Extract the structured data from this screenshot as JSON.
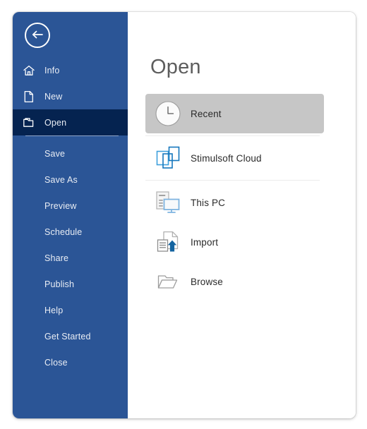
{
  "window": {
    "accent_blue": "#2b5596",
    "accent_blue_active": "#052350",
    "selected_row_gray": "#c6c6c6",
    "icon_blue": "#1e86c8"
  },
  "sidebar": {
    "back_button": {
      "name": "back-arrow-button",
      "icon": "back-arrow-icon"
    },
    "items": [
      {
        "label": "Info",
        "icon": "home-icon",
        "icon_type": "home",
        "active": false,
        "has_icon": true,
        "separator_after": false
      },
      {
        "label": "New",
        "icon": "page-icon",
        "icon_type": "page",
        "active": false,
        "has_icon": true,
        "separator_after": false
      },
      {
        "label": "Open",
        "icon": "folder-icon",
        "icon_type": "folder",
        "active": true,
        "has_icon": true,
        "separator_after": true
      },
      {
        "label": "Save",
        "icon": "",
        "icon_type": "",
        "active": false,
        "has_icon": false,
        "separator_after": false
      },
      {
        "label": "Save As",
        "icon": "",
        "icon_type": "",
        "active": false,
        "has_icon": false,
        "separator_after": false
      },
      {
        "label": "Preview",
        "icon": "",
        "icon_type": "",
        "active": false,
        "has_icon": false,
        "separator_after": false
      },
      {
        "label": "Schedule",
        "icon": "",
        "icon_type": "",
        "active": false,
        "has_icon": false,
        "separator_after": false
      },
      {
        "label": "Share",
        "icon": "",
        "icon_type": "",
        "active": false,
        "has_icon": false,
        "separator_after": false
      },
      {
        "label": "Publish",
        "icon": "",
        "icon_type": "",
        "active": false,
        "has_icon": false,
        "separator_after": false
      },
      {
        "label": "Help",
        "icon": "",
        "icon_type": "",
        "active": false,
        "has_icon": false,
        "separator_after": false
      },
      {
        "label": "Get Started",
        "icon": "",
        "icon_type": "",
        "active": false,
        "has_icon": false,
        "separator_after": false
      },
      {
        "label": "Close",
        "icon": "",
        "icon_type": "",
        "active": false,
        "has_icon": false,
        "separator_after": false
      }
    ]
  },
  "main": {
    "title": "Open",
    "items": [
      {
        "label": "Recent",
        "icon": "clock-icon",
        "icon_type": "clock",
        "selected": true,
        "separator_after": true
      },
      {
        "label": "Stimulsoft Cloud",
        "icon": "cloud-windows-icon",
        "icon_type": "cloud",
        "selected": false,
        "separator_after": true
      },
      {
        "label": "This PC",
        "icon": "computer-icon",
        "icon_type": "computer",
        "selected": false,
        "separator_after": false
      },
      {
        "label": "Import",
        "icon": "import-document-icon",
        "icon_type": "import",
        "selected": false,
        "separator_after": false
      },
      {
        "label": "Browse",
        "icon": "open-folder-icon",
        "icon_type": "browse",
        "selected": false,
        "separator_after": false
      }
    ]
  }
}
